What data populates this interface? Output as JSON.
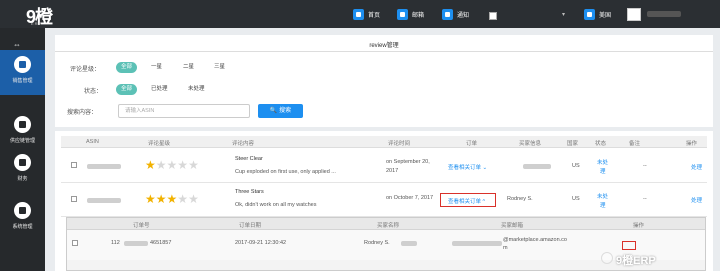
{
  "header": {
    "logo": "9橙",
    "logo_sub": "ERP",
    "nav": [
      {
        "label": "首页",
        "icon": "home-icon"
      },
      {
        "label": "邮箱",
        "icon": "mail-icon"
      },
      {
        "label": "通知",
        "icon": "bell-icon"
      }
    ],
    "user": {
      "label": "美国",
      "icon": "flag-icon"
    }
  },
  "sidebar": {
    "items": [
      {
        "label": "销售管理",
        "icon": "grid-icon",
        "active": true
      },
      {
        "label": "供应链管理",
        "icon": "cart-icon",
        "active": false
      },
      {
        "label": "财务",
        "icon": "money-icon",
        "active": false
      },
      {
        "label": "系统管理",
        "icon": "play-icon",
        "active": false
      }
    ]
  },
  "panel": {
    "title": "review管理",
    "filters": {
      "rating_label": "评论星级：",
      "rating_options": [
        "全部",
        "一星",
        "二星",
        "三星"
      ],
      "status_label": "状态：",
      "status_options": [
        "全部",
        "已处理",
        "未处理"
      ],
      "search_label": "搜索内容：",
      "search_placeholder": "请输入ASIN",
      "search_button": "搜索"
    },
    "table": {
      "columns": [
        "ASIN",
        "评论星级",
        "评论内容",
        "评论时间",
        "订单",
        "买家信息",
        "国家",
        "状态",
        "备注",
        "操作"
      ],
      "rows": [
        {
          "stars": 1,
          "title": "Steer Clear",
          "content": "Cup exploded on first use, only applied ...",
          "time_line1": "on September 20,",
          "time_line2": "2017",
          "order_link": "查看相关订单 ⌄",
          "buyer": "",
          "country": "US",
          "status_line1": "未处",
          "status_line2": "理",
          "note": "--",
          "action": "处理"
        },
        {
          "stars": 3,
          "title": "Three Stars",
          "content": "Ok, didn't work on all my watches",
          "time_line1": "on October 7, 2017",
          "time_line2": "",
          "order_link": "查看相关订单 ^",
          "buyer": "Rodney S.",
          "country": "US",
          "status_line1": "未处",
          "status_line2": "理",
          "note": "--",
          "action": "处理"
        }
      ]
    },
    "subtable": {
      "columns": [
        "订单号",
        "订单日期",
        "买家名称",
        "买家邮箱",
        "操作"
      ],
      "row": {
        "order_prefix": "112",
        "order_suffix": "4651857",
        "date": "2017-09-21 12:30:42",
        "buyer": "Rodney S.",
        "email_suffix": "@marketplace.amazon.co",
        "email_line2": "m"
      }
    }
  },
  "watermark": "9橙ERP",
  "colors": {
    "accent": "#1d8ff0",
    "teal": "#5cc1b6",
    "sidebar": "#26292c",
    "highlight": "#d9312a",
    "star": "#f2b200"
  }
}
